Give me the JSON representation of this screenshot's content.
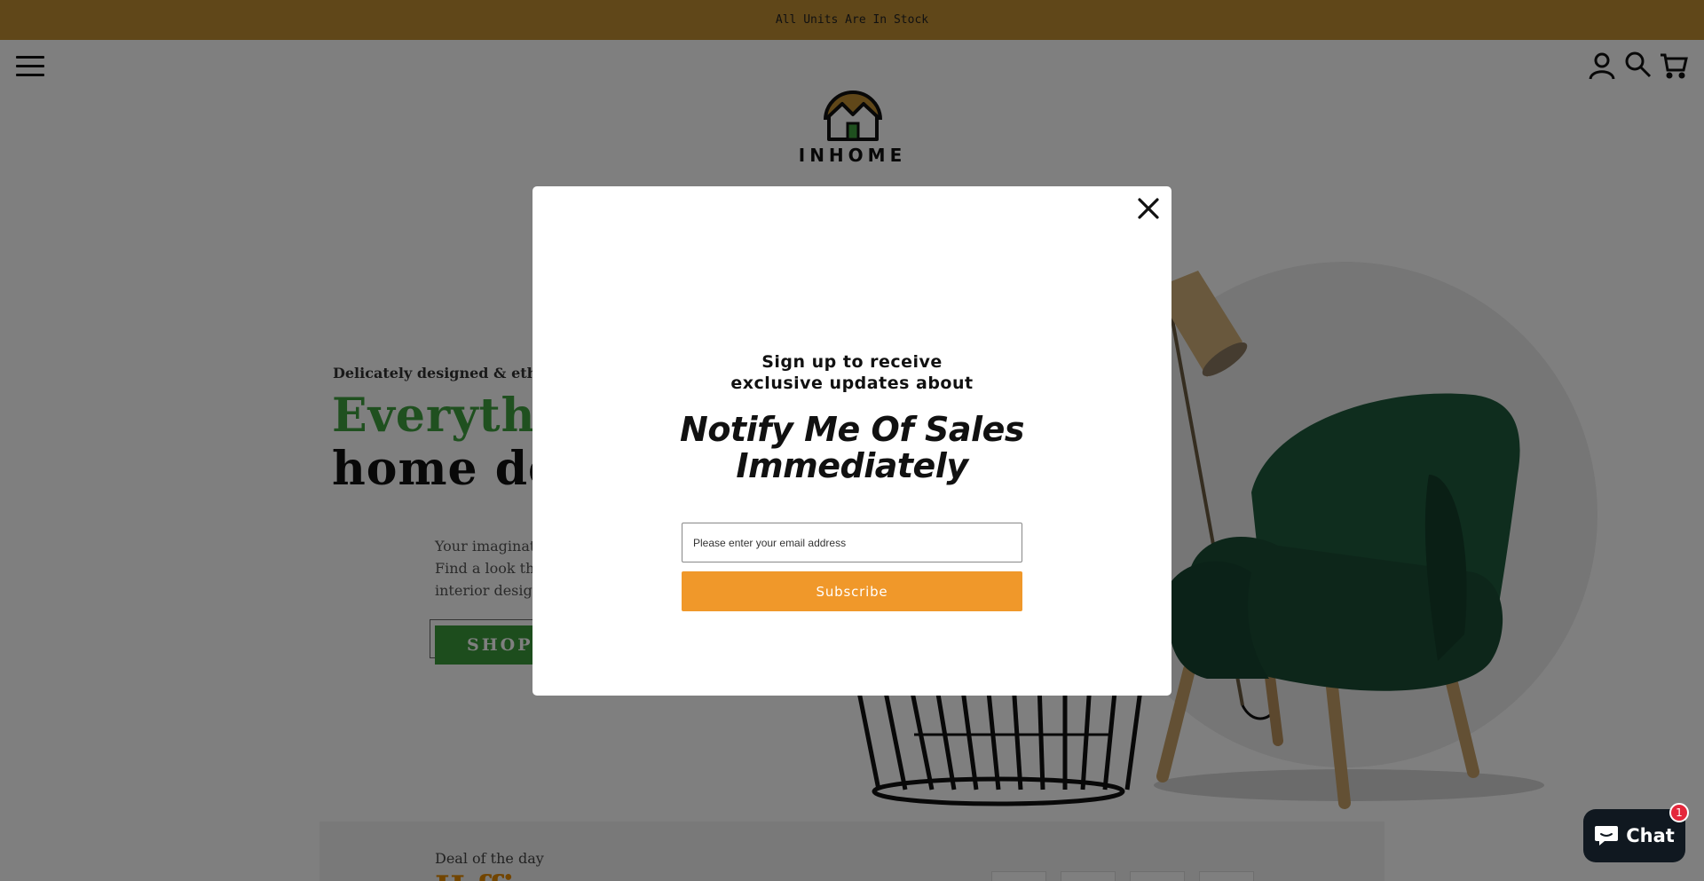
{
  "announcement": {
    "text": "All Units Are In Stock",
    "bg_color": "#c08e33"
  },
  "header": {
    "menu_icon": "hamburger-icon",
    "logo_text": "INHOME",
    "icons": [
      "account-icon",
      "search-icon",
      "cart-icon"
    ]
  },
  "hero": {
    "subtitle": "Delicately designed & ethica",
    "title_line1": "Everythi",
    "title_line2": "home de",
    "description": [
      "Your imaginat",
      "Find a look tha",
      "interior design"
    ],
    "cta_label": "SHOP A",
    "accent_color": "#3ea03e"
  },
  "deal": {
    "label": "Deal of the day",
    "highlight_color": "#e58a00"
  },
  "modal": {
    "heading_line1": "Sign up to receive",
    "heading_line2": "exclusive updates about",
    "title_line1": "Notify Me Of Sales",
    "title_line2": "Immediately",
    "email_placeholder": "Please enter your email address",
    "subscribe_label": "Subscribe",
    "button_color": "#f0982a",
    "close_icon": "close-icon"
  },
  "chat": {
    "label": "Chat",
    "badge_count": "1",
    "icon": "chat-bubble-icon"
  }
}
